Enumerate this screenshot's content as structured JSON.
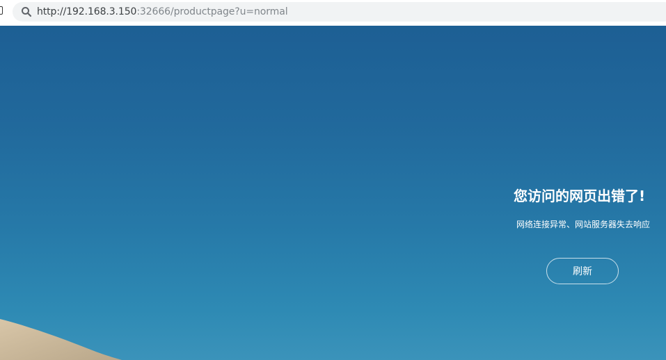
{
  "browser": {
    "address_bar": {
      "url_host": "http://192.168.3.150",
      "url_rest": ":32666/productpage?u=normal"
    }
  },
  "error_page": {
    "title": "您访问的网页出错了!",
    "subtitle": "网络连接异常、网站服务器失去响应",
    "refresh_label": "刷新"
  },
  "colors": {
    "sky_top": "#1d5f94",
    "sky_bottom": "#3b93ba",
    "dune": "#c9b79a"
  }
}
